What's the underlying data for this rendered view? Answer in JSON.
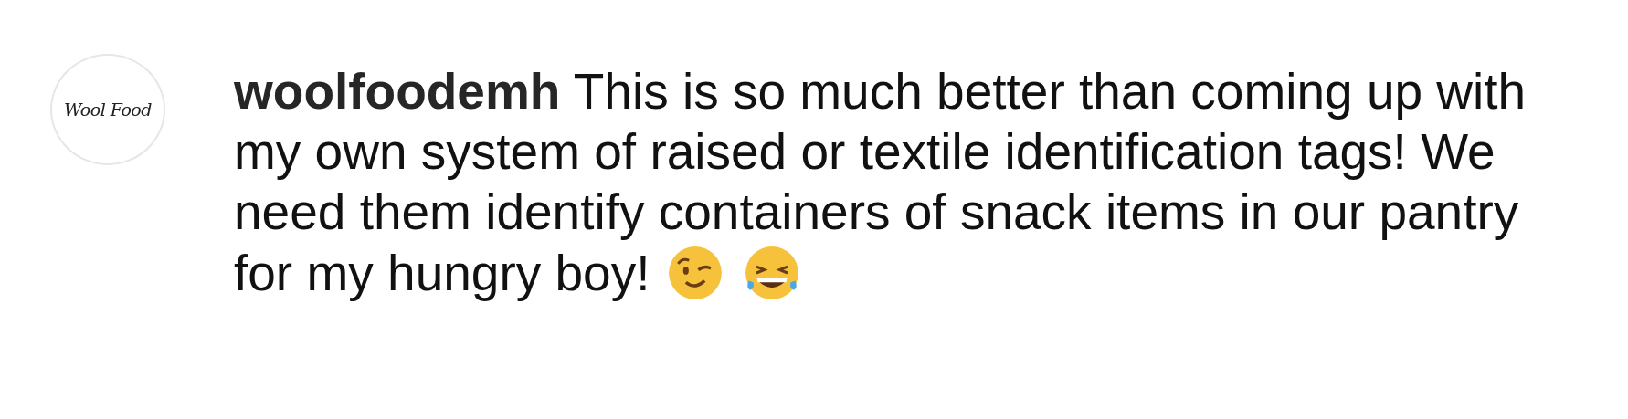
{
  "comment": {
    "avatar": {
      "logo_text": "Wool Food"
    },
    "lines": [
      "**woolfoodemh** This is so much better than coming up with",
      "my own system of raised or textile identification tags! We",
      "need them identify containers of snack items in our pantry",
      "for my hungry boy!"
    ],
    "emojis": [
      {
        "kind": "wink"
      },
      {
        "kind": "laugh"
      }
    ]
  }
}
